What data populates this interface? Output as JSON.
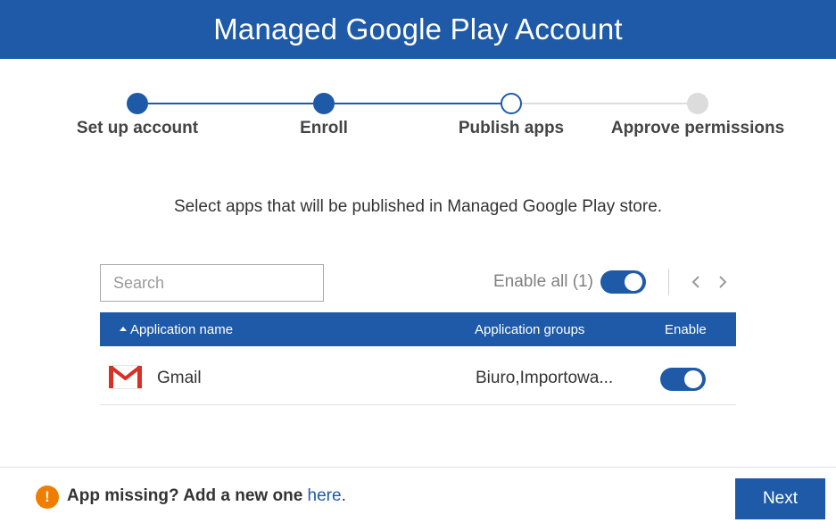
{
  "header": {
    "title": "Managed Google Play Account"
  },
  "stepper": {
    "steps": [
      {
        "label": "Set up account",
        "state": "done"
      },
      {
        "label": "Enroll",
        "state": "done"
      },
      {
        "label": "Publish apps",
        "state": "current"
      },
      {
        "label": "Approve permissions",
        "state": "todo"
      }
    ]
  },
  "instruction": "Select apps that will be published in Managed Google Play store.",
  "toolbar": {
    "search_placeholder": "Search",
    "search_value": "",
    "enable_all_label": "Enable all (1)",
    "enable_all_on": true,
    "prev_icon": "chevron-left-icon",
    "next_icon": "chevron-right-icon"
  },
  "table": {
    "columns": [
      "Application name",
      "Application groups",
      "Enable"
    ],
    "sorted_column": "Application name",
    "sort_direction": "ascending",
    "rows": [
      {
        "icon": "gmail-icon",
        "name": "Gmail",
        "groups": "Biuro,Importowa...",
        "enabled": true
      }
    ]
  },
  "footer": {
    "warning_icon": "exclamation-icon",
    "message": "App missing? Add a new one",
    "link_text": "here",
    "period": ".",
    "next_label": "Next"
  },
  "colors": {
    "primary": "#1e5aa8",
    "warning": "#f07d00",
    "inactive_step": "#dcdcdc",
    "gmail_red": "#d93025"
  }
}
